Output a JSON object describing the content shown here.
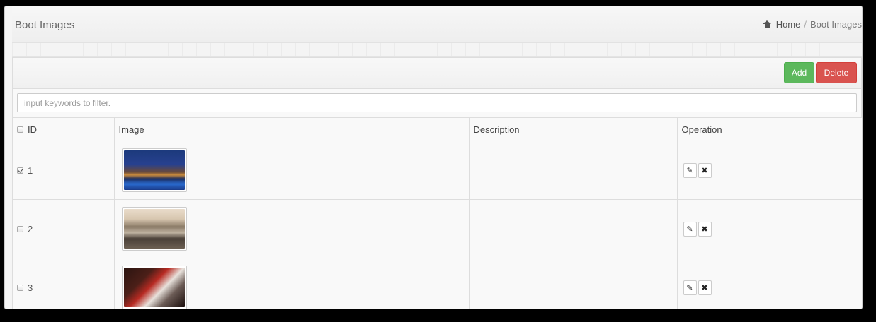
{
  "header": {
    "title": "Boot Images",
    "breadcrumb": {
      "home": "Home",
      "separator": "/",
      "current": "Boot Images"
    }
  },
  "toolbar": {
    "add_label": "Add",
    "delete_label": "Delete"
  },
  "filter": {
    "placeholder": "input keywords to filter."
  },
  "table": {
    "columns": {
      "id": "ID",
      "image": "Image",
      "description": "Description",
      "operation": "Operation"
    },
    "rows": [
      {
        "id": "1",
        "checked": true,
        "image": "resort-pool-night",
        "description": ""
      },
      {
        "id": "2",
        "checked": false,
        "image": "hotel-room",
        "description": ""
      },
      {
        "id": "3",
        "checked": false,
        "image": "dining-table",
        "description": ""
      }
    ]
  },
  "icons": {
    "edit": "pencil-icon",
    "delete": "close-icon",
    "home": "home-icon"
  },
  "colors": {
    "add": "#5cb85c",
    "delete": "#d9534f"
  }
}
